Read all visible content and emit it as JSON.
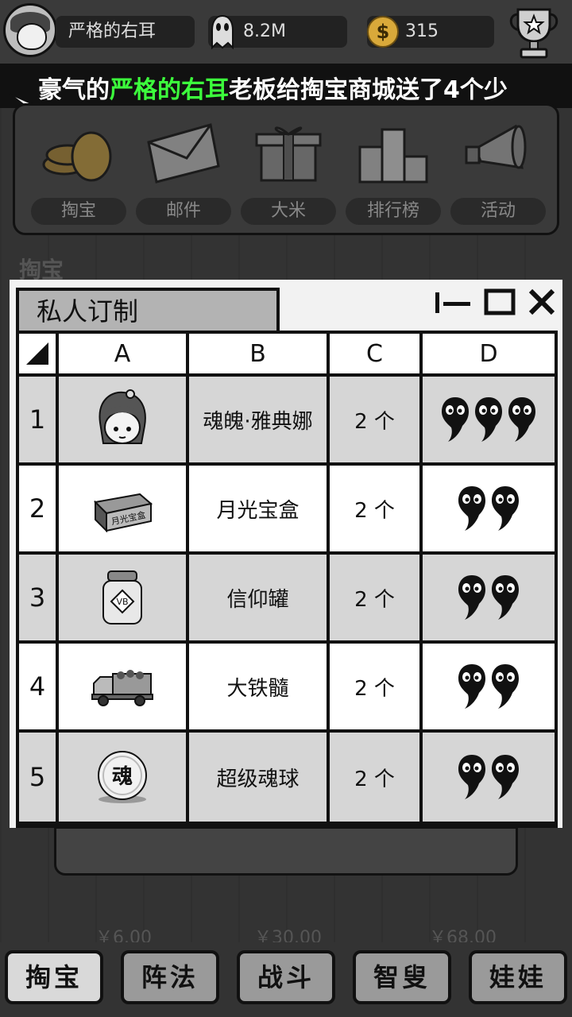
{
  "topbar": {
    "player_name": "严格的右耳",
    "ghost_value": "8.2M",
    "coin_value": "315",
    "coin_symbol": "$"
  },
  "marquee": {
    "prefix": "豪气的",
    "highlight": "严格的右耳",
    "suffix": "老板给掏宝商城送了4个少"
  },
  "menu": {
    "items": [
      {
        "label": "掏宝",
        "icon": "coins-icon"
      },
      {
        "label": "邮件",
        "icon": "envelope-icon"
      },
      {
        "label": "大米",
        "icon": "gift-box-icon"
      },
      {
        "label": "排行榜",
        "icon": "podium-icon"
      },
      {
        "label": "活动",
        "icon": "megaphone-icon"
      }
    ]
  },
  "section_title": "掏宝",
  "prices": [
    "￥6.00",
    "￥30.00",
    "￥68.00"
  ],
  "window": {
    "title": "私人订制",
    "columns": [
      "A",
      "B",
      "C",
      "D"
    ],
    "rows": [
      {
        "num": "1",
        "icon": "athena-avatar-icon",
        "name": "魂魄·雅典娜",
        "qty": "2 个",
        "souls": 3
      },
      {
        "num": "2",
        "icon": "moonlight-box-icon",
        "name": "月光宝盒",
        "qty": "2 个",
        "souls": 2
      },
      {
        "num": "3",
        "icon": "faith-jar-icon",
        "name": "信仰罐",
        "qty": "2 个",
        "souls": 2
      },
      {
        "num": "4",
        "icon": "truck-icon",
        "name": "大铁髓",
        "qty": "2 个",
        "souls": 2
      },
      {
        "num": "5",
        "icon": "soul-ball-icon",
        "name": "超级魂球",
        "qty": "2 个",
        "souls": 2
      }
    ],
    "ball_char": "魂",
    "box_text": "月光宝盒",
    "jar_text": "VB"
  },
  "bottom_nav": [
    "掏宝",
    "阵法",
    "战斗",
    "智叟",
    "娃娃"
  ]
}
